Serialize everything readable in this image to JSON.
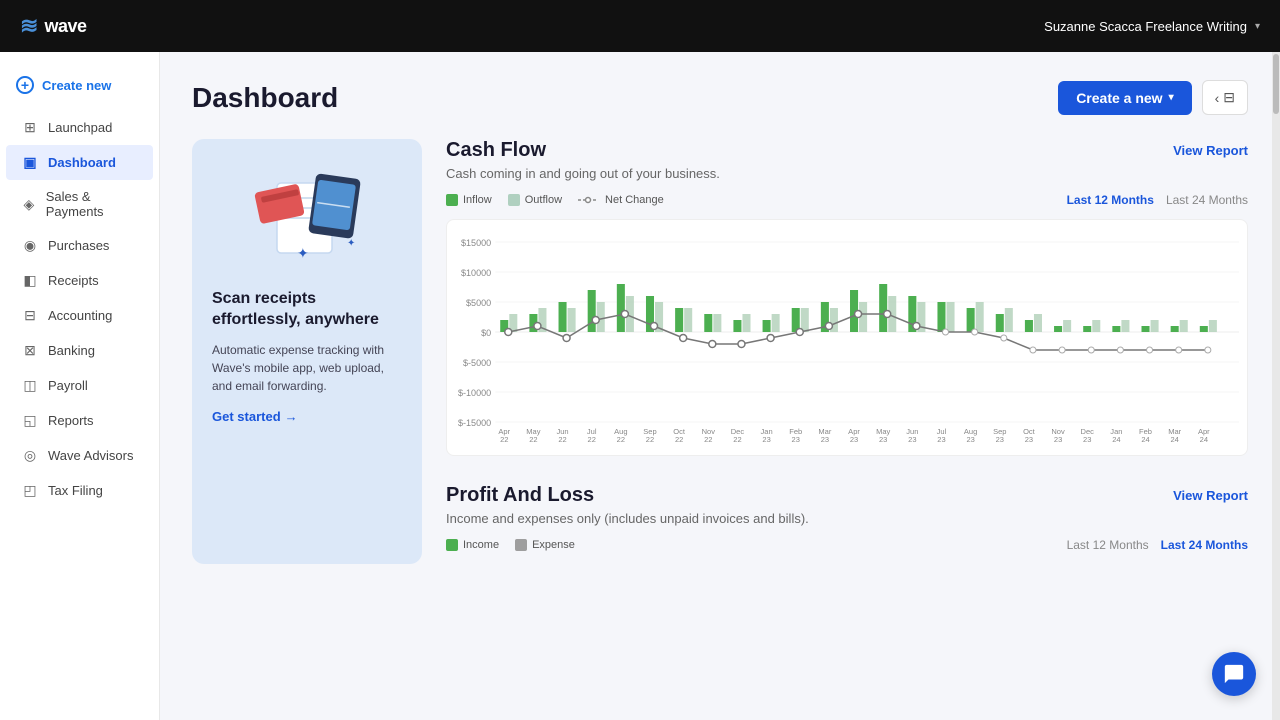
{
  "topBar": {
    "logoIcon": "≋",
    "logoText": "wave",
    "userName": "Suzanne Scacca Freelance Writing"
  },
  "sidebar": {
    "createNew": "Create new",
    "items": [
      {
        "id": "launchpad",
        "label": "Launchpad",
        "icon": "⊞",
        "active": false
      },
      {
        "id": "dashboard",
        "label": "Dashboard",
        "icon": "◫",
        "active": true
      },
      {
        "id": "sales",
        "label": "Sales & Payments",
        "icon": "💳",
        "active": false
      },
      {
        "id": "purchases",
        "label": "Purchases",
        "icon": "🛒",
        "active": false
      },
      {
        "id": "receipts",
        "label": "Receipts",
        "icon": "🧾",
        "active": false
      },
      {
        "id": "accounting",
        "label": "Accounting",
        "icon": "📊",
        "active": false
      },
      {
        "id": "banking",
        "label": "Banking",
        "icon": "🏦",
        "active": false
      },
      {
        "id": "payroll",
        "label": "Payroll",
        "icon": "💼",
        "active": false
      },
      {
        "id": "reports",
        "label": "Reports",
        "icon": "📄",
        "active": false
      },
      {
        "id": "wave-advisors",
        "label": "Wave Advisors",
        "icon": "👤",
        "active": false
      },
      {
        "id": "tax-filing",
        "label": "Tax Filing",
        "icon": "📋",
        "active": false
      }
    ]
  },
  "pageHeader": {
    "title": "Dashboard",
    "createNewBtn": "Create a new",
    "navBackIcon": "‹",
    "navGridIcon": "⊟"
  },
  "promoCard": {
    "title": "Scan receipts effortlessly, anywhere",
    "description": "Automatic expense tracking with Wave's mobile app, web upload, and email forwarding.",
    "linkText": "Get started",
    "linkArrow": "→"
  },
  "cashFlow": {
    "title": "Cash Flow",
    "description": "Cash coming in and going out of your business.",
    "viewReport": "View Report",
    "legend": [
      {
        "id": "inflow",
        "label": "Inflow",
        "color": "#4caf50",
        "type": "bar"
      },
      {
        "id": "outflow",
        "label": "Outflow",
        "color": "#b0d0c0",
        "type": "bar"
      },
      {
        "id": "netchange",
        "label": "Net Change",
        "color": "#888",
        "type": "line"
      }
    ],
    "timeFilters": [
      {
        "label": "Last 12 Months",
        "active": true
      },
      {
        "label": "Last 24 Months",
        "active": false
      }
    ],
    "yLabels": [
      "$15000",
      "$10000",
      "$5000",
      "$0",
      "$-5000",
      "$-10000",
      "$-15000"
    ],
    "xLabels": [
      "Apr\n22",
      "May\n22",
      "Jun\n22",
      "Jul\n22",
      "Aug\n22",
      "Sep\n22",
      "Oct\n22",
      "Nov\n22",
      "Dec\n22",
      "Jan\n23",
      "Feb\n23",
      "Mar\n23",
      "Apr\n23",
      "May\n23",
      "Jun\n23",
      "Jul\n23",
      "Aug\n23",
      "Sep\n23",
      "Oct\n23",
      "Nov\n23",
      "Dec\n23",
      "Jan\n24",
      "Feb\n24",
      "Mar\n24",
      "Apr\n24"
    ],
    "bars": {
      "inflow": [
        2,
        3,
        5,
        7,
        8,
        6,
        4,
        3,
        2,
        2,
        4,
        5,
        7,
        8,
        6,
        5,
        4,
        3,
        2,
        1,
        1,
        1,
        1,
        1,
        1
      ],
      "outflow": [
        3,
        4,
        4,
        5,
        6,
        5,
        4,
        3,
        3,
        3,
        4,
        4,
        5,
        6,
        5,
        5,
        5,
        4,
        3,
        2,
        2,
        2,
        2,
        2,
        2
      ]
    },
    "netChange": [
      0,
      1,
      -1,
      2,
      3,
      1,
      -1,
      -2,
      -2,
      -1,
      0,
      1,
      2,
      3,
      1,
      0,
      0,
      -1,
      -2,
      -3,
      -3,
      -3,
      -3,
      -3,
      -3
    ]
  },
  "profitAndLoss": {
    "title": "Profit And Loss",
    "description": "Income and expenses only (includes unpaid invoices and bills).",
    "viewReport": "View Report",
    "legend": [
      {
        "id": "income",
        "label": "Income",
        "color": "#4caf50"
      },
      {
        "id": "expense",
        "label": "Expense",
        "color": "#9e9e9e"
      }
    ],
    "timeFilters": [
      {
        "label": "Last 12 Months",
        "active": false
      },
      {
        "label": "Last 24 Months",
        "active": true
      }
    ]
  },
  "chat": {
    "icon": "💬"
  }
}
